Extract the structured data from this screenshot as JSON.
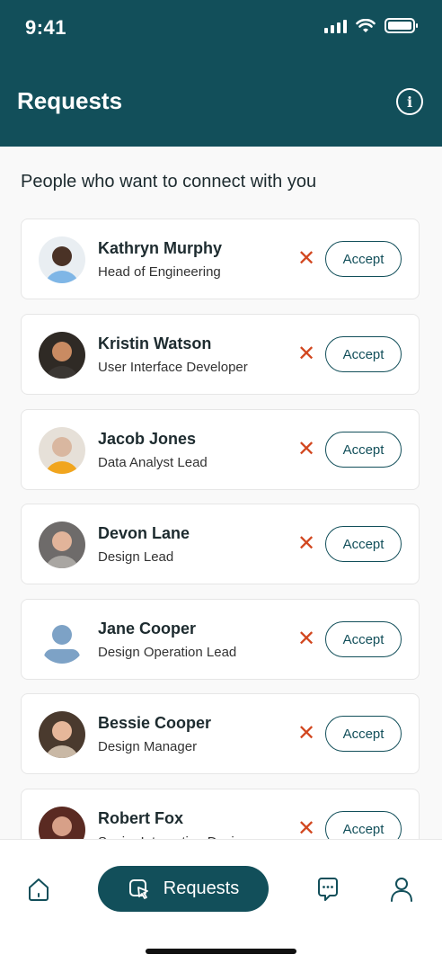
{
  "status_bar": {
    "time": "9:41"
  },
  "header": {
    "title": "Requests",
    "info_icon": "info-icon"
  },
  "main": {
    "subtitle": "People who want to connect with you",
    "accept_label": "Accept",
    "requests": [
      {
        "name": "Kathryn Murphy",
        "role": "Head of Engineering"
      },
      {
        "name": "Kristin Watson",
        "role": "User Interface Developer"
      },
      {
        "name": "Jacob Jones",
        "role": "Data Analyst Lead"
      },
      {
        "name": "Devon Lane",
        "role": "Design Lead"
      },
      {
        "name": "Jane Cooper",
        "role": "Design Operation Lead"
      },
      {
        "name": "Bessie Cooper",
        "role": "Design Manager"
      },
      {
        "name": "Robert Fox",
        "role": "Senior Interaction Designer"
      }
    ]
  },
  "tabbar": {
    "active_label": "Requests",
    "icons": [
      "home-icon",
      "requests-icon",
      "chat-icon",
      "profile-icon"
    ]
  },
  "colors": {
    "primary": "#124f5a",
    "reject": "#d2471f",
    "background": "#f9f9f9"
  }
}
